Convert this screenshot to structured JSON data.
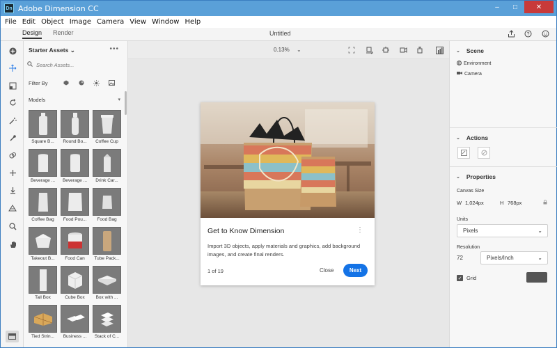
{
  "window": {
    "title": "Adobe Dimension CC",
    "logo": "Dn",
    "controls": [
      "–",
      "□",
      "✕"
    ]
  },
  "menu": [
    "File",
    "Edit",
    "Object",
    "Image",
    "Camera",
    "View",
    "Window",
    "Help"
  ],
  "tabs": {
    "design": "Design",
    "render": "Render",
    "document_title": "Untitled"
  },
  "assets": {
    "header": "Starter Assets",
    "more": "•••",
    "search_placeholder": "Search Assets...",
    "filter_label": "Filter By",
    "models_label": "Models",
    "items": [
      "Square B...",
      "Round Bo...",
      "Coffee Cup",
      "Beverage ...",
      "Beverage ...",
      "Drink Car...",
      "Coffee Bag",
      "Food Pou...",
      "Food Bag",
      "Takeout B...",
      "Food Can",
      "Tube Pack...",
      "Tall Box",
      "Cube Box",
      "Box with ...",
      "Tied Strin...",
      "Business ...",
      "Stack of C..."
    ]
  },
  "canvas": {
    "zoom": "0.13%"
  },
  "card": {
    "title": "Get to Know Dimension",
    "description": "Import 3D objects, apply materials and graphics, add background images, and create final renders.",
    "page": "1 of 19",
    "close_label": "Close",
    "next_label": "Next"
  },
  "scene": {
    "title": "Scene",
    "environment": "Environment",
    "camera": "Camera"
  },
  "actions": {
    "title": "Actions"
  },
  "properties": {
    "title": "Properties",
    "canvas_size_label": "Canvas Size",
    "w_label": "W",
    "w_value": "1,024px",
    "h_label": "H",
    "h_value": "768px",
    "units_label": "Units",
    "units_value": "Pixels",
    "resolution_label": "Resolution",
    "resolution_value": "72",
    "resolution_unit": "Pixels/Inch",
    "grid_label": "Grid",
    "grid_color": "#555555"
  },
  "colors": {
    "accent": "#1473e6",
    "titlebar": "#5aa0d8"
  }
}
